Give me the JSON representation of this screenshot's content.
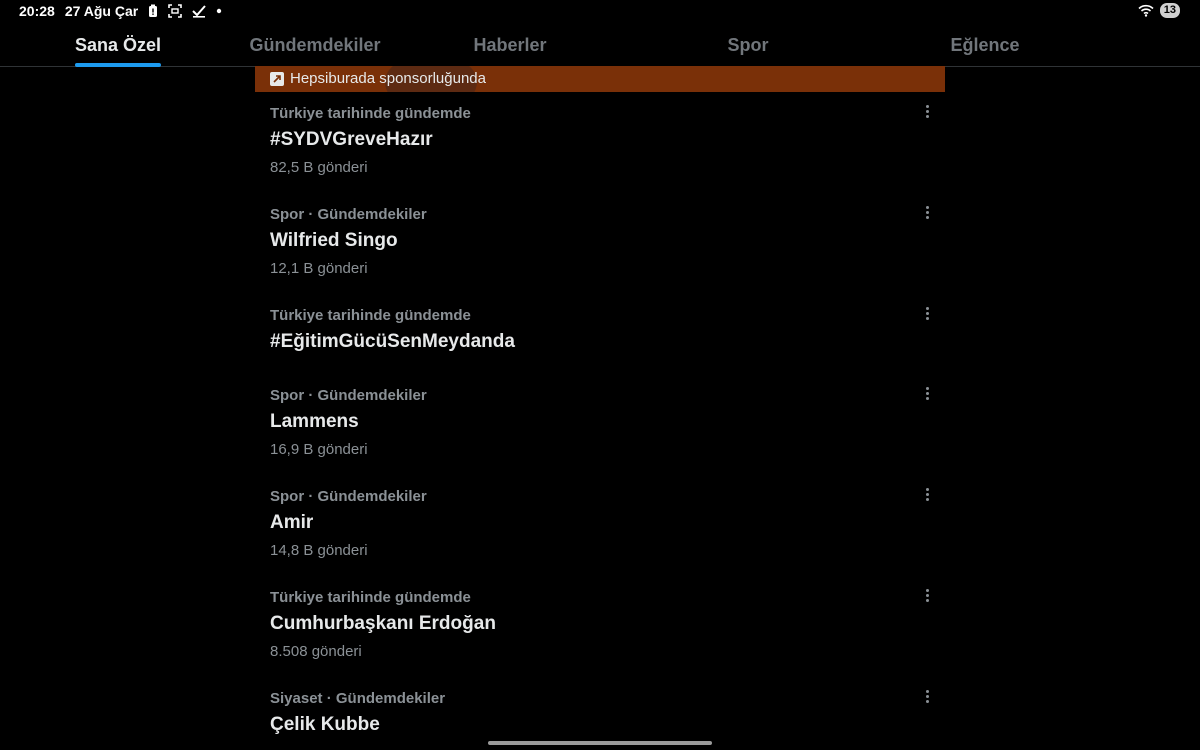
{
  "status_bar": {
    "time": "20:28",
    "date": "27 Ağu Çar",
    "icons": [
      "battery-saver-icon",
      "screenshot-icon",
      "check-icon",
      "notification-dot"
    ],
    "battery_level": "13"
  },
  "tabs": [
    {
      "label": "Sana Özel",
      "active": true
    },
    {
      "label": "Gündemdekiler",
      "active": false
    },
    {
      "label": "Haberler",
      "active": false
    },
    {
      "label": "Spor",
      "active": false
    },
    {
      "label": "Eğlence",
      "active": false
    }
  ],
  "promo": {
    "label": "Hepsiburada sponsorluğunda",
    "color": "#7a3008"
  },
  "trends": [
    {
      "context": "Türkiye tarihinde gündemde",
      "title": "#SYDVGreveHazır",
      "count": "82,5 B gönderi"
    },
    {
      "context": "Spor · Gündemdekiler",
      "title": "Wilfried Singo",
      "count": "12,1 B gönderi"
    },
    {
      "context": "Türkiye tarihinde gündemde",
      "title": "#EğitimGücüSenMeydanda",
      "count": ""
    },
    {
      "context": "Spor · Gündemdekiler",
      "title": "Lammens",
      "count": "16,9 B gönderi"
    },
    {
      "context": "Spor · Gündemdekiler",
      "title": "Amir",
      "count": "14,8 B gönderi"
    },
    {
      "context": "Türkiye tarihinde gündemde",
      "title": "Cumhurbaşkanı Erdoğan",
      "count": "8.508 gönderi"
    },
    {
      "context": "Siyaset · Gündemdekiler",
      "title": "Çelik Kubbe",
      "count": ""
    }
  ],
  "colors": {
    "accent": "#1d9bf0",
    "background": "#000000",
    "secondary_text": "#8b9196"
  }
}
